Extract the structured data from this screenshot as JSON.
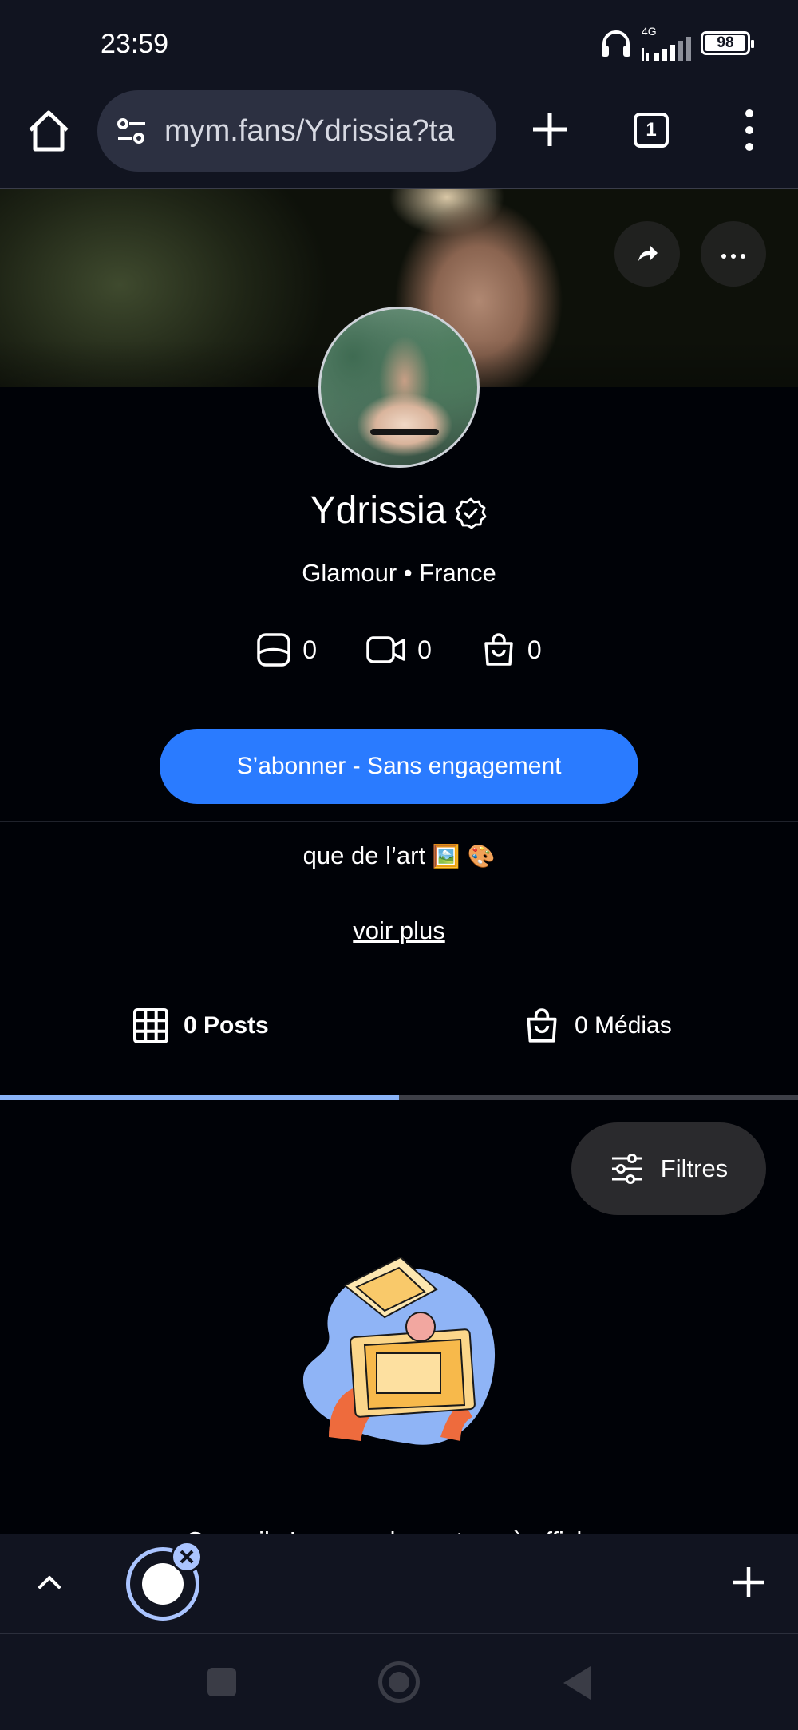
{
  "status_bar": {
    "time": "23:59",
    "network": "4G",
    "battery": "98"
  },
  "browser": {
    "url": "mym.fans/Ydrissia?ta",
    "tab_count": "1"
  },
  "profile": {
    "name": "Ydrissia",
    "subtitle": "Glamour • France",
    "stats": {
      "photos": "0",
      "videos": "0",
      "shop": "0"
    },
    "subscribe_label": "S’abonner - Sans engagement",
    "bio": "que de l’art",
    "bio_emojis": "🖼️ 🎨",
    "see_more": "voir plus"
  },
  "tabs": {
    "posts": "0 Posts",
    "medias": "0 Médias",
    "active": "posts"
  },
  "filters_label": "Filtres",
  "empty_text": "Oups, il n'y a pas de contenu à afficher",
  "colors": {
    "accent": "#2a7bff",
    "tab_indicator": "#8ab4f8",
    "browser_chrome": "#111420"
  }
}
